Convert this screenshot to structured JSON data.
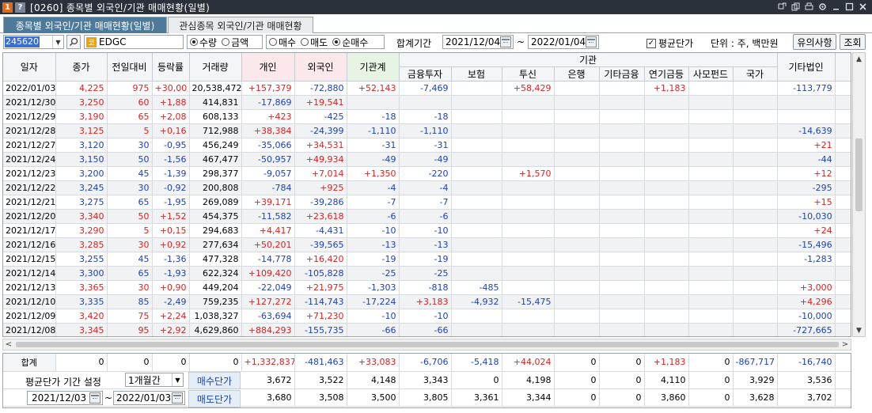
{
  "window": {
    "badge1": "1",
    "badge2": "?",
    "title": "[0260] 종목별 외국인/기관 매매현황(일별)"
  },
  "tabs": [
    {
      "label": "종목별 외국인/기관 매매현황(일별)"
    },
    {
      "label": "관심종목 외국인/기관 매매현황"
    }
  ],
  "toolbar": {
    "code": "245620",
    "name_badge": "코",
    "name": "EDGC",
    "radio_group1": [
      {
        "label": "수량",
        "checked": true
      },
      {
        "label": "금액",
        "checked": false
      }
    ],
    "radio_group2": [
      {
        "label": "매수",
        "checked": false
      },
      {
        "label": "매도",
        "checked": false
      },
      {
        "label": "순매수",
        "checked": true
      }
    ],
    "period_label": "합계기간",
    "start_date": "2021/12/04",
    "tilde": "~",
    "end_date": "2022/01/04",
    "avg_price_label": "평균단가",
    "avg_price_checked": true,
    "unit_label": "단위 : 주, 백만원",
    "notes_button": "유의사항",
    "query_button": "조회"
  },
  "grid": {
    "headers": {
      "date": "일자",
      "close": "종가",
      "change": "전일대비",
      "rate": "등락률",
      "volume": "거래량",
      "individual": "개인",
      "foreign": "외국인",
      "inst_total": "기관계",
      "inst_group": "기관",
      "finance": "금융투자",
      "insurance": "보험",
      "trust": "투신",
      "bank": "은행",
      "other_fin": "기타금융",
      "pension": "연기금등",
      "private_fund": "사모펀드",
      "nation": "국가",
      "other_corp": "기타법인",
      "overflow": "기"
    },
    "rows": [
      {
        "date": "2022/01/03",
        "close": "4,225",
        "change": "975",
        "rate": "+30,00",
        "volume": "20,538,472",
        "individual": "+157,379",
        "foreign": "-72,880",
        "inst_total": "+52,143",
        "finance": "-7,469",
        "insurance": "",
        "trust": "+58,429",
        "bank": "",
        "other_fin": "",
        "pension": "+1,183",
        "private_fund": "",
        "nation": "",
        "other_corp": "-113,779",
        "dir": "up"
      },
      {
        "date": "2021/12/30",
        "close": "3,250",
        "change": "60",
        "rate": "+1,88",
        "volume": "414,831",
        "individual": "-17,869",
        "foreign": "+19,541",
        "inst_total": "",
        "finance": "",
        "insurance": "",
        "trust": "",
        "bank": "",
        "other_fin": "",
        "pension": "",
        "private_fund": "",
        "nation": "",
        "other_corp": "",
        "dir": "up"
      },
      {
        "date": "2021/12/29",
        "close": "3,190",
        "change": "65",
        "rate": "+2,08",
        "volume": "608,133",
        "individual": "+423",
        "foreign": "-425",
        "inst_total": "-18",
        "finance": "-18",
        "insurance": "",
        "trust": "",
        "bank": "",
        "other_fin": "",
        "pension": "",
        "private_fund": "",
        "nation": "",
        "other_corp": "",
        "dir": "up"
      },
      {
        "date": "2021/12/28",
        "close": "3,125",
        "change": "5",
        "rate": "+0,16",
        "volume": "712,988",
        "individual": "+38,384",
        "foreign": "-24,399",
        "inst_total": "-1,110",
        "finance": "-1,110",
        "insurance": "",
        "trust": "",
        "bank": "",
        "other_fin": "",
        "pension": "",
        "private_fund": "",
        "nation": "",
        "other_corp": "-14,639",
        "dir": "up"
      },
      {
        "date": "2021/12/27",
        "close": "3,120",
        "change": "30",
        "rate": "-0,95",
        "volume": "456,249",
        "individual": "-35,066",
        "foreign": "+34,531",
        "inst_total": "-31",
        "finance": "-31",
        "insurance": "",
        "trust": "",
        "bank": "",
        "other_fin": "",
        "pension": "",
        "private_fund": "",
        "nation": "",
        "other_corp": "+21",
        "dir": "down"
      },
      {
        "date": "2021/12/24",
        "close": "3,150",
        "change": "50",
        "rate": "-1,56",
        "volume": "467,477",
        "individual": "-50,957",
        "foreign": "+49,934",
        "inst_total": "-49",
        "finance": "-49",
        "insurance": "",
        "trust": "",
        "bank": "",
        "other_fin": "",
        "pension": "",
        "private_fund": "",
        "nation": "",
        "other_corp": "-44",
        "dir": "down"
      },
      {
        "date": "2021/12/23",
        "close": "3,200",
        "change": "45",
        "rate": "-1,39",
        "volume": "298,377",
        "individual": "-9,057",
        "foreign": "+7,014",
        "inst_total": "+1,350",
        "finance": "-220",
        "insurance": "",
        "trust": "+1,570",
        "bank": "",
        "other_fin": "",
        "pension": "",
        "private_fund": "",
        "nation": "",
        "other_corp": "+12",
        "dir": "down"
      },
      {
        "date": "2021/12/22",
        "close": "3,245",
        "change": "30",
        "rate": "-0,92",
        "volume": "200,808",
        "individual": "-784",
        "foreign": "+925",
        "inst_total": "-4",
        "finance": "-4",
        "insurance": "",
        "trust": "",
        "bank": "",
        "other_fin": "",
        "pension": "",
        "private_fund": "",
        "nation": "",
        "other_corp": "-295",
        "dir": "down"
      },
      {
        "date": "2021/12/21",
        "close": "3,275",
        "change": "65",
        "rate": "-1,95",
        "volume": "269,089",
        "individual": "+39,171",
        "foreign": "-39,286",
        "inst_total": "-7",
        "finance": "-7",
        "insurance": "",
        "trust": "",
        "bank": "",
        "other_fin": "",
        "pension": "",
        "private_fund": "",
        "nation": "",
        "other_corp": "+15",
        "dir": "down"
      },
      {
        "date": "2021/12/20",
        "close": "3,340",
        "change": "50",
        "rate": "+1,52",
        "volume": "454,375",
        "individual": "-11,582",
        "foreign": "+23,618",
        "inst_total": "-6",
        "finance": "-6",
        "insurance": "",
        "trust": "",
        "bank": "",
        "other_fin": "",
        "pension": "",
        "private_fund": "",
        "nation": "",
        "other_corp": "-10,030",
        "dir": "up"
      },
      {
        "date": "2021/12/17",
        "close": "3,290",
        "change": "5",
        "rate": "+0,15",
        "volume": "294,683",
        "individual": "+4,417",
        "foreign": "-4,431",
        "inst_total": "-10",
        "finance": "-10",
        "insurance": "",
        "trust": "",
        "bank": "",
        "other_fin": "",
        "pension": "",
        "private_fund": "",
        "nation": "",
        "other_corp": "+24",
        "dir": "up"
      },
      {
        "date": "2021/12/16",
        "close": "3,285",
        "change": "30",
        "rate": "+0,92",
        "volume": "277,634",
        "individual": "+50,201",
        "foreign": "-39,565",
        "inst_total": "-13",
        "finance": "-13",
        "insurance": "",
        "trust": "",
        "bank": "",
        "other_fin": "",
        "pension": "",
        "private_fund": "",
        "nation": "",
        "other_corp": "-15,496",
        "dir": "up"
      },
      {
        "date": "2021/12/15",
        "close": "3,255",
        "change": "45",
        "rate": "-1,36",
        "volume": "477,328",
        "individual": "-14,778",
        "foreign": "+16,420",
        "inst_total": "-19",
        "finance": "-19",
        "insurance": "",
        "trust": "",
        "bank": "",
        "other_fin": "",
        "pension": "",
        "private_fund": "",
        "nation": "",
        "other_corp": "-1,283",
        "dir": "down"
      },
      {
        "date": "2021/12/14",
        "close": "3,300",
        "change": "65",
        "rate": "-1,93",
        "volume": "622,324",
        "individual": "+109,420",
        "foreign": "-105,828",
        "inst_total": "-25",
        "finance": "-25",
        "insurance": "",
        "trust": "",
        "bank": "",
        "other_fin": "",
        "pension": "",
        "private_fund": "",
        "nation": "",
        "other_corp": "",
        "dir": "down"
      },
      {
        "date": "2021/12/13",
        "close": "3,365",
        "change": "30",
        "rate": "+0,90",
        "volume": "449,204",
        "individual": "-22,049",
        "foreign": "+21,975",
        "inst_total": "-1,303",
        "finance": "-818",
        "insurance": "-485",
        "trust": "",
        "bank": "",
        "other_fin": "",
        "pension": "",
        "private_fund": "",
        "nation": "",
        "other_corp": "+3,000",
        "dir": "up"
      },
      {
        "date": "2021/12/10",
        "close": "3,335",
        "change": "85",
        "rate": "-2,49",
        "volume": "759,235",
        "individual": "+127,272",
        "foreign": "-114,743",
        "inst_total": "-17,224",
        "finance": "+3,183",
        "insurance": "-4,932",
        "trust": "-15,475",
        "bank": "",
        "other_fin": "",
        "pension": "",
        "private_fund": "",
        "nation": "",
        "other_corp": "+4,296",
        "dir": "down"
      },
      {
        "date": "2021/12/09",
        "close": "3,420",
        "change": "75",
        "rate": "+2,24",
        "volume": "1,038,327",
        "individual": "-63,694",
        "foreign": "+71,230",
        "inst_total": "-10",
        "finance": "-10",
        "insurance": "",
        "trust": "",
        "bank": "",
        "other_fin": "",
        "pension": "",
        "private_fund": "",
        "nation": "",
        "other_corp": "-10,000",
        "dir": "up"
      },
      {
        "date": "2021/12/08",
        "close": "3,345",
        "change": "95",
        "rate": "+2,92",
        "volume": "4,629,860",
        "individual": "+884,293",
        "foreign": "-155,735",
        "inst_total": "-66",
        "finance": "-66",
        "insurance": "",
        "trust": "",
        "bank": "",
        "other_fin": "",
        "pension": "",
        "private_fund": "",
        "nation": "",
        "other_corp": "-727,665",
        "dir": "up"
      }
    ]
  },
  "totals": {
    "label": "합계",
    "close": "0",
    "change": "0",
    "rate": "0",
    "volume": "0",
    "individual": "+1,332,837",
    "foreign": "-481,463",
    "inst_total": "+33,083",
    "finance": "-6,706",
    "insurance": "-5,418",
    "trust": "+44,024",
    "bank": "0",
    "other_fin": "0",
    "pension": "+1,183",
    "private_fund": "0",
    "nation": "-867,717",
    "other_corp": "-16,740"
  },
  "avg": {
    "period_setting_label": "평균단가 기간 설정",
    "period_value": "1개월간",
    "start_date": "2021/12/03",
    "tilde": "~",
    "end_date": "2022/01/03",
    "buy_label": "매수단가",
    "sell_label": "매도단가",
    "buy": [
      "3,672",
      "3,522",
      "4,148",
      "3,343",
      "0",
      "4,198",
      "0",
      "0",
      "4,110",
      "0",
      "3,929",
      "3,536"
    ],
    "sell": [
      "3,680",
      "3,508",
      "3,500",
      "3,805",
      "3,361",
      "3,344",
      "0",
      "0",
      "3,860",
      "0",
      "3,628",
      "3,702"
    ]
  },
  "colors": {
    "up": "#e02020",
    "down": "#1c3fbf",
    "active_tab": "#4d7a9a",
    "title_bar": "#2b313b",
    "selected_code": "#3c6fd6"
  }
}
